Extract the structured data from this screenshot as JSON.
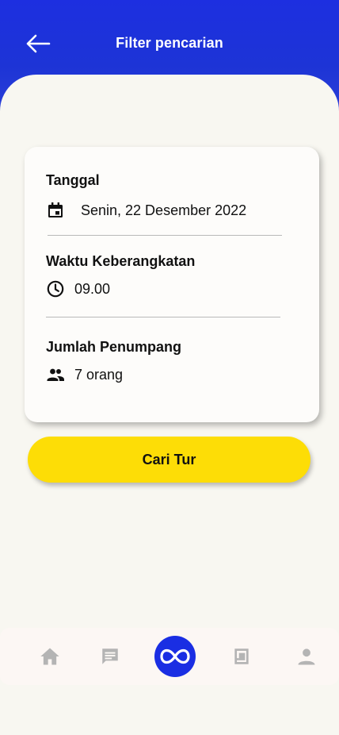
{
  "header": {
    "title": "Filter pencarian",
    "back_icon": "arrow-left-icon",
    "background": "#1d2fe0"
  },
  "filters": {
    "date": {
      "label": "Tanggal",
      "value": "Senin, 22 Desember 2022",
      "icon": "calendar-icon"
    },
    "departure_time": {
      "label": "Waktu Keberangkatan",
      "value": "09.00",
      "icon": "clock-icon"
    },
    "passengers": {
      "label": "Jumlah Penumpang",
      "value": "7 orang",
      "icon": "people-icon"
    }
  },
  "search_button": {
    "label": "Cari Tur",
    "color": "#fddd06"
  },
  "bottom_nav": {
    "items": [
      {
        "icon": "home-icon"
      },
      {
        "icon": "chat-icon"
      },
      {
        "icon": "infinity-icon",
        "active": true
      },
      {
        "icon": "book-icon"
      },
      {
        "icon": "profile-icon"
      }
    ],
    "active_color": "#1a2ee3",
    "inactive_color": "#b4b4b4"
  }
}
